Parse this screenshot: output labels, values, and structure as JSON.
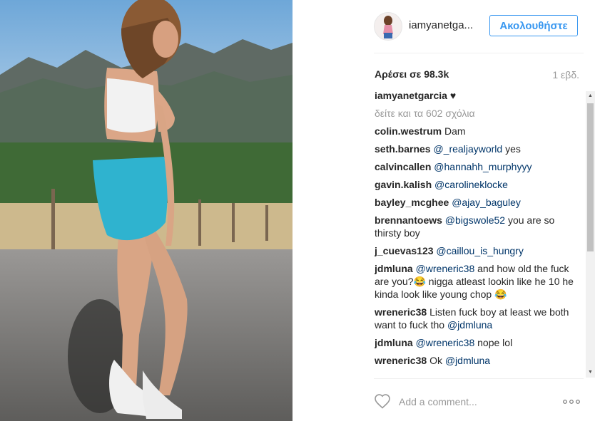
{
  "post": {
    "username": "iamyanetga...",
    "follow_label": "Ακολουθήστε",
    "likes": "Αρέσει σε 98.3k",
    "time": "1 εβδ.",
    "caption_user": "iamyanetgarcia",
    "caption_text": "♥",
    "view_all": "δείτε και τα 602 σχόλια",
    "comment_placeholder": "Add a comment..."
  },
  "comments": [
    {
      "user": "colin.westrum",
      "mention": "",
      "text": "Dam"
    },
    {
      "user": "seth.barnes",
      "mention": "@_realjayworld",
      "text": "yes"
    },
    {
      "user": "calvincallen",
      "mention": "@hannahh_murphyyy",
      "text": ""
    },
    {
      "user": "gavin.kalish",
      "mention": "@carolineklocke",
      "text": ""
    },
    {
      "user": "bayley_mcghee",
      "mention": "@ajay_baguley",
      "text": ""
    },
    {
      "user": "brennantoews",
      "mention": "@bigswole52",
      "text": "you are so thirsty boy"
    },
    {
      "user": "j_cuevas123",
      "mention": "@caillou_is_hungry",
      "text": ""
    },
    {
      "user": "jdmluna",
      "mention": "@wreneric38",
      "text": "and how old the fuck are you?😂 nigga atleast lookin like he 10 he kinda look like young chop 😂"
    },
    {
      "user": "wreneric38",
      "mention": "",
      "text": "Listen fuck boy at least we both want to fuck tho",
      "mention_after": "@jdmluna"
    },
    {
      "user": "jdmluna",
      "mention": "@wreneric38",
      "text": "nope lol"
    },
    {
      "user": "wreneric38",
      "mention": "",
      "text": "Ok",
      "mention_after": "@jdmluna"
    }
  ],
  "icons": {
    "like": "heart-outline-icon",
    "more": "ellipsis-icon",
    "scroll_up": "scroll-up-arrow-icon",
    "scroll_down": "scroll-down-arrow-icon"
  },
  "colors": {
    "accent": "#3897f0",
    "mention": "#003569",
    "muted": "#999999"
  }
}
